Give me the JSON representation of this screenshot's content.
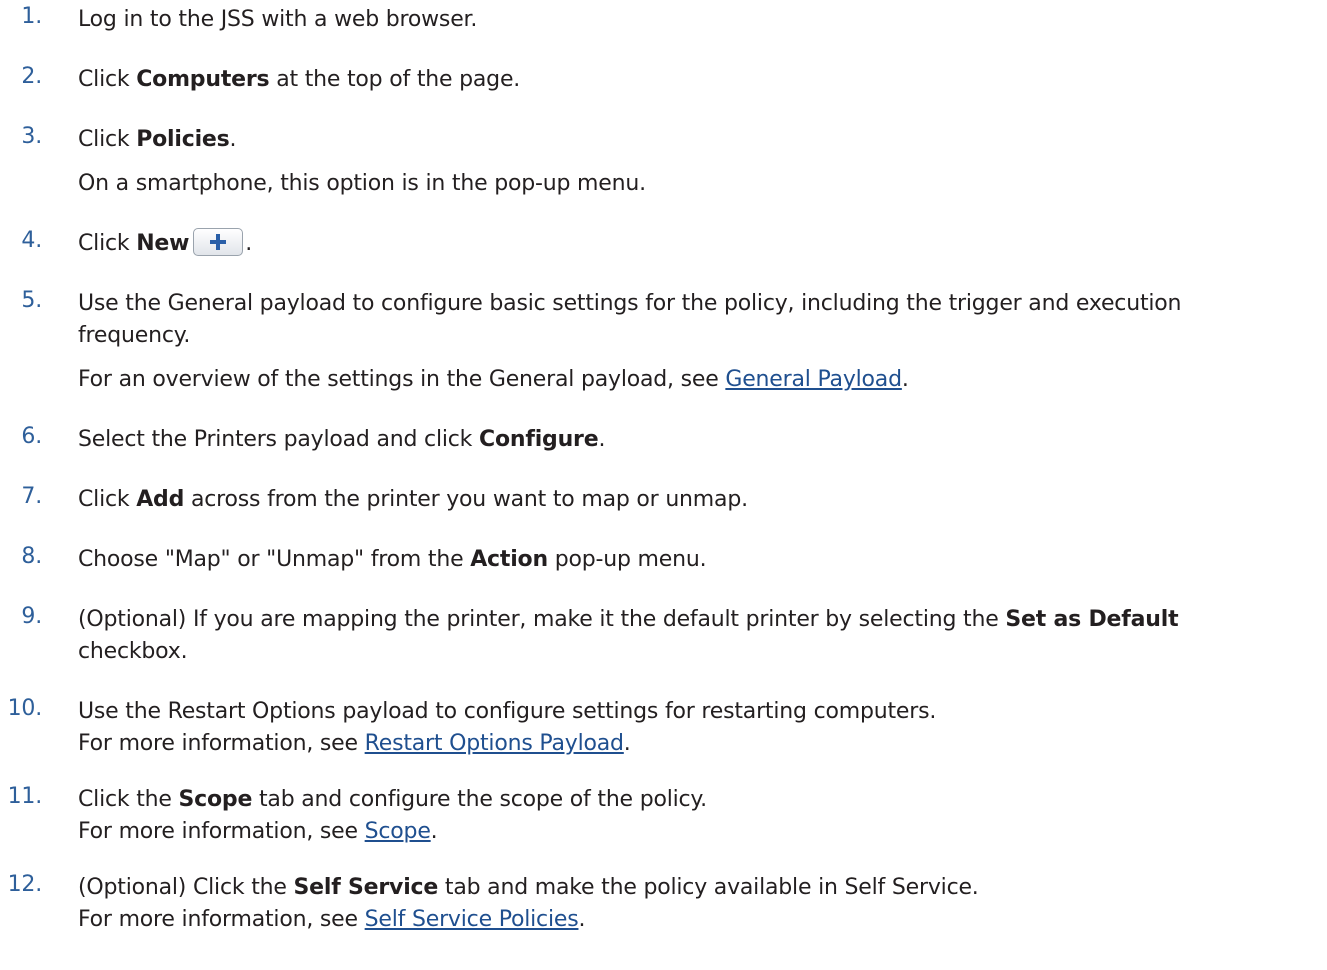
{
  "steps": [
    {
      "num": "1.",
      "text": "Log in to the JSS with a web browser."
    },
    {
      "num": "2.",
      "pre": "Click ",
      "bold": "Computers",
      "post": " at the top of the page."
    },
    {
      "num": "3.",
      "pre": "Click ",
      "bold": "Policies",
      "post": ".",
      "note": "On a smartphone, this option is in the pop-up menu."
    },
    {
      "num": "4.",
      "pre": "Click ",
      "bold": "New",
      "post": ".",
      "icon": "plus-icon"
    },
    {
      "num": "5.",
      "line1": "Use the General payload to configure basic settings for the policy, including the trigger and execution",
      "line2": "frequency.",
      "note_pre": "For an overview of the settings in the General payload, see ",
      "note_link": "General Payload",
      "note_post": "."
    },
    {
      "num": "6.",
      "pre": "Select the Printers payload and click ",
      "bold": "Configure",
      "post": "."
    },
    {
      "num": "7.",
      "pre": "Click ",
      "bold": "Add",
      "post": " across from the printer you want to map or unmap."
    },
    {
      "num": "8.",
      "pre": "Choose \"Map\" or \"Unmap\" from the ",
      "bold": "Action",
      "post": " pop-up menu."
    },
    {
      "num": "9.",
      "pre": "(Optional) If you are mapping the printer, make it the default printer by selecting the ",
      "bold": "Set as Default",
      "line2": "checkbox."
    },
    {
      "num": "10.",
      "text": "Use the Restart Options payload to configure settings for restarting computers.",
      "note_pre": "For more information, see ",
      "note_link": "Restart Options Payload",
      "note_post": "."
    },
    {
      "num": "11.",
      "pre": "Click the ",
      "bold": "Scope",
      "post": " tab and configure the scope of the policy.",
      "note_pre": "For more information, see ",
      "note_link": "Scope",
      "note_post": "."
    },
    {
      "num": "12.",
      "pre": "(Optional) Click the ",
      "bold": "Self Service",
      "post": " tab and make the policy available in Self Service.",
      "note_pre": "For more information, see ",
      "note_link": "Self Service Policies",
      "note_post": "."
    }
  ],
  "colors": {
    "number": "#2e5f9a",
    "link": "#1f4f8f",
    "text": "#231f20",
    "icon": "#2a5fa8"
  }
}
